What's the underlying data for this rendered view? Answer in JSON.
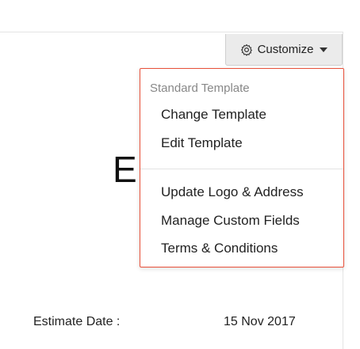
{
  "toolbar": {
    "customize_label": "Customize"
  },
  "document": {
    "heading_partial": "E",
    "estimate_date_label": "Estimate Date :",
    "estimate_date_value": "15 Nov 2017"
  },
  "menu": {
    "section_header": "Standard Template",
    "items": [
      {
        "label": "Change Template"
      },
      {
        "label": "Edit Template"
      },
      {
        "label": "Update Logo & Address"
      },
      {
        "label": "Manage Custom Fields"
      },
      {
        "label": "Terms & Conditions"
      }
    ]
  },
  "colors": {
    "dropdown_border": "#e8503a",
    "button_bg": "#ebebeb",
    "muted_text": "#888888"
  }
}
